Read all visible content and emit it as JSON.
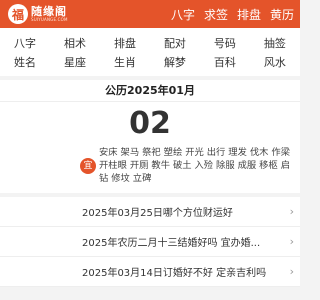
{
  "header": {
    "logo_mark": "福",
    "logo_name": "随缘阁",
    "logo_sub": "SUIYUANGE.COM",
    "nav": [
      "八字",
      "求签",
      "排盘",
      "黄历"
    ]
  },
  "categories": [
    "八字",
    "相术",
    "排盘",
    "配对",
    "号码",
    "抽签",
    "姓名",
    "星座",
    "生肖",
    "解梦",
    "百科",
    "风水"
  ],
  "calendar": {
    "title": "公历2025年01月",
    "day": "02",
    "yi_label": "宜",
    "yi_text": "安床 架马 祭祀 塑绘 开光 出行 理发 伐木 作梁 开柱眼 开厕 教牛 破土 入殓 除服 成服 移柩 启钻 修坟 立碑"
  },
  "articles": [
    {
      "title": "2025年03月25日哪个方位财运好"
    },
    {
      "title": "2025年农历二月十三结婚好吗 宜办婚..."
    },
    {
      "title": "2025年03月14日订婚好不好 定亲吉利吗"
    }
  ],
  "colors": {
    "accent": "#e4542a",
    "background": "#f3f3f3"
  }
}
